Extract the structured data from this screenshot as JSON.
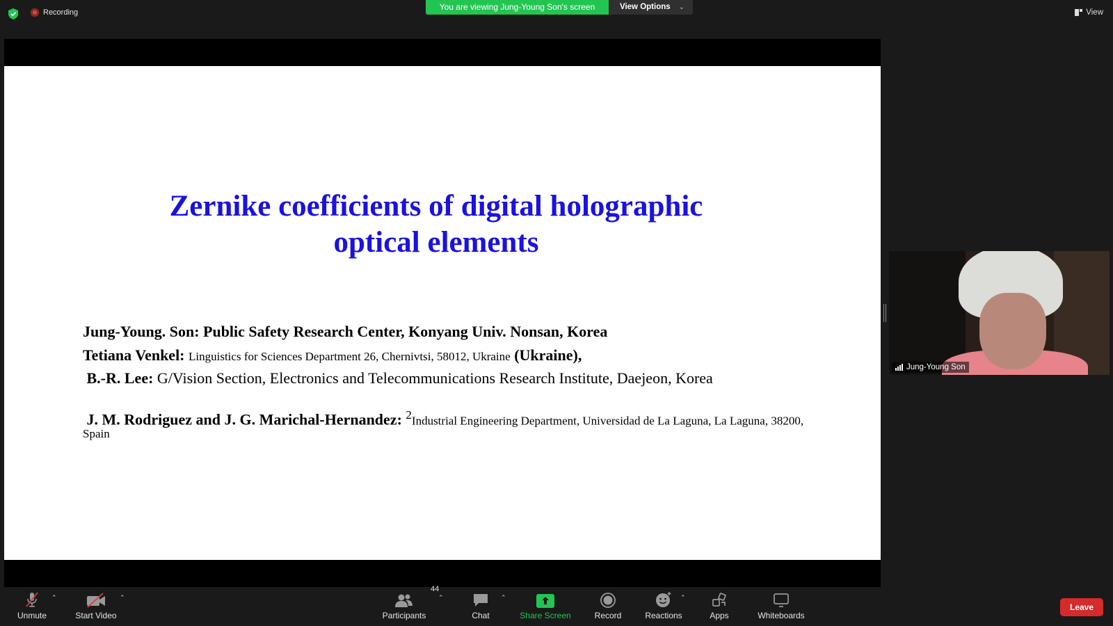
{
  "top": {
    "recording_label": "Recording",
    "banner_text": "You are viewing Jung-Young Son's screen",
    "view_options_label": "View Options",
    "view_label": "View"
  },
  "slide": {
    "title_line1": "Zernike coefficients of digital holographic",
    "title_line2": "optical elements",
    "author1_name": "Jung-Young. Son: Public Safety Research Center, Konyang Univ.  Nonsan, Korea",
    "author2_name": "Tetiana Venkel:",
    "author2_affil": "Linguistics for Sciences Department 26, Chernivtsi, 58012, Ukraine",
    "author2_country": "(Ukraine),",
    "author3_name": "B.-R. Lee:",
    "author3_affil": "G/Vision Section, Electronics and Telecommunications Research Institute, Daejeon, Korea",
    "author4_name": "J. M. Rodriguez and  J. G. Marichal-Hernandez:",
    "author4_sup": "2",
    "author4_affil": "Industrial Engineering Department, Universidad de La Laguna, La Laguna, 38200, Spain"
  },
  "video": {
    "participant_name": "Jung-Young Son"
  },
  "toolbar": {
    "unmute_label": "Unmute",
    "start_video_label": "Start Video",
    "participants_label": "Participants",
    "participants_count": "44",
    "chat_label": "Chat",
    "share_screen_label": "Share Screen",
    "record_label": "Record",
    "reactions_label": "Reactions",
    "apps_label": "Apps",
    "whiteboards_label": "Whiteboards",
    "leave_label": "Leave"
  },
  "colors": {
    "banner_green": "#23c552",
    "title_blue": "#1a12e0",
    "leave_red": "#d52b2b"
  }
}
